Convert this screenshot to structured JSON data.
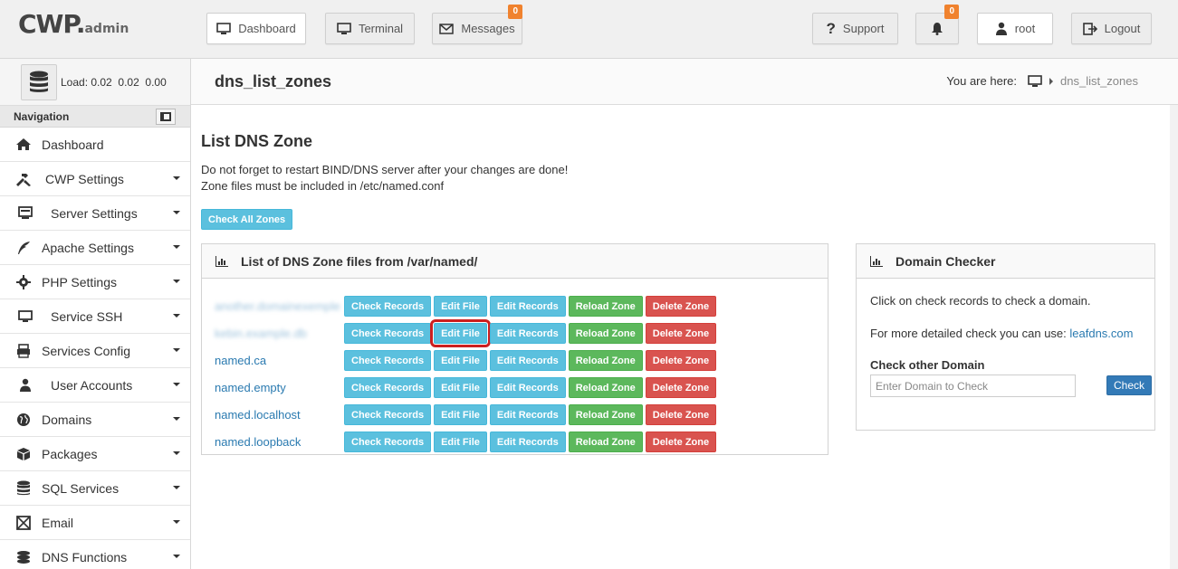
{
  "brand": {
    "logo_main": "CWP",
    "logo_dot": ".",
    "logo_sub": "admin"
  },
  "header": {
    "dashboard": "Dashboard",
    "terminal": "Terminal",
    "messages": "Messages",
    "messages_count": "0",
    "support": "Support",
    "notifications_count": "0",
    "user": "root",
    "logout": "Logout"
  },
  "sidebar": {
    "load_label": "Load:",
    "load_values": "0.02  0.02  0.00",
    "nav_title": "Navigation",
    "items": [
      {
        "label": "Dashboard",
        "icon": "home-icon",
        "has_caret": false
      },
      {
        "label": "CWP Settings",
        "icon": "tools-icon",
        "has_caret": true
      },
      {
        "label": "Server Settings",
        "icon": "server-icon",
        "has_caret": true
      },
      {
        "label": "Apache Settings",
        "icon": "feather-icon",
        "has_caret": true
      },
      {
        "label": "PHP Settings",
        "icon": "gear-icon",
        "has_caret": true
      },
      {
        "label": "Service SSH",
        "icon": "monitor-icon",
        "has_caret": true
      },
      {
        "label": "Services Config",
        "icon": "printer-icon",
        "has_caret": true
      },
      {
        "label": "User Accounts",
        "icon": "user-icon",
        "has_caret": true
      },
      {
        "label": "Domains",
        "icon": "globe-icon",
        "has_caret": true
      },
      {
        "label": "Packages",
        "icon": "box-icon",
        "has_caret": true
      },
      {
        "label": "SQL Services",
        "icon": "database-icon",
        "has_caret": true
      },
      {
        "label": "Email",
        "icon": "mail-icon",
        "has_caret": true
      },
      {
        "label": "DNS Functions",
        "icon": "stack-icon",
        "has_caret": true
      }
    ]
  },
  "page": {
    "title": "dns_list_zones",
    "breadcrumb_prefix": "You are here:",
    "breadcrumb_current": "dns_list_zones"
  },
  "main": {
    "heading": "List DNS Zone",
    "note_line1": "Do not forget to restart BIND/DNS server after your changes are done!",
    "note_line2": "Zone files must be included in /etc/named.conf",
    "check_all": "Check All Zones",
    "zones_panel_title": "List of DNS Zone files from /var/named/",
    "zone_buttons": {
      "check_records": "Check Records",
      "edit_file": "Edit File",
      "edit_records": "Edit Records",
      "reload_zone": "Reload Zone",
      "delete_zone": "Delete Zone"
    },
    "zones": [
      {
        "name": "another.domainexemple",
        "blurred": true
      },
      {
        "name": "kebin.example.db",
        "blurred": true
      },
      {
        "name": "named.ca",
        "blurred": false
      },
      {
        "name": "named.empty",
        "blurred": false
      },
      {
        "name": "named.localhost",
        "blurred": false
      },
      {
        "name": "named.loopback",
        "blurred": false
      }
    ]
  },
  "domain_checker": {
    "title": "Domain Checker",
    "line1": "Click on check records to check a domain.",
    "line2_prefix": "For more detailed check you can use: ",
    "line2_link": "leafdns.com",
    "label": "Check other Domain",
    "placeholder": "Enter Domain to Check",
    "button": "Check"
  },
  "colors": {
    "info": "#5bc0de",
    "success": "#5cb85c",
    "danger": "#d9534f",
    "primary": "#337ab7",
    "badge": "#f0822e",
    "highlight": "#cc1f1f"
  }
}
